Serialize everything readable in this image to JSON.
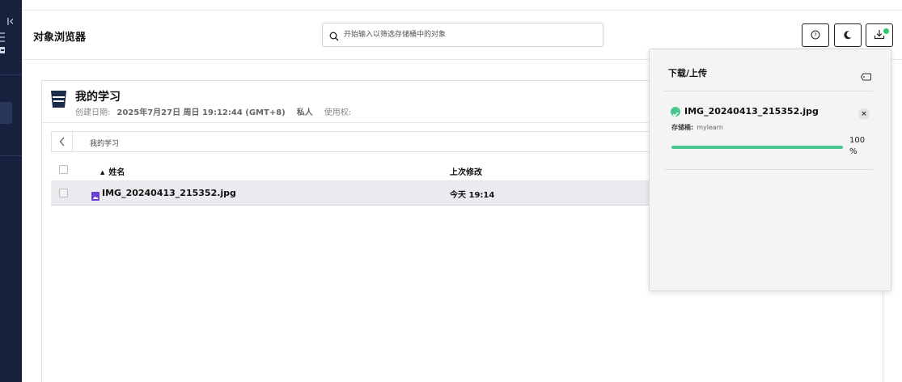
{
  "sidebar": {
    "collapse_icon": "collapse-left-icon",
    "menu_icon": "menu-icon",
    "bucket_icon": "bucket-icon"
  },
  "header": {
    "title": "对象浏览器",
    "search_placeholder": "开始输入以筛选存储桶中的对象",
    "help_icon": "help-icon",
    "theme_icon": "moon-icon",
    "transfers_icon": "download-icon"
  },
  "bucket": {
    "name": "我的学习",
    "created_label": "创建日期:",
    "created_value": "2025年7月27日 周日 19:12:44 (GMT+8)",
    "access": "私人",
    "usage_label": "使用权:"
  },
  "path": {
    "crumb": "我的学习"
  },
  "table": {
    "columns": [
      "姓名",
      "上次修改"
    ],
    "rows": [
      {
        "name": "IMG_20240413_215352.jpg",
        "modified": "今天 19:14"
      }
    ]
  },
  "transfers": {
    "title": "下载/上传",
    "items": [
      {
        "file": "IMG_20240413_215352.jpg",
        "bucket_label": "存储桶:",
        "bucket": "mylearn",
        "progress": 100,
        "progress_text": "100 %"
      }
    ]
  },
  "colors": {
    "rail": "#16213e",
    "accent_green": "#48c78e",
    "selected_row": "#e9ebee"
  }
}
